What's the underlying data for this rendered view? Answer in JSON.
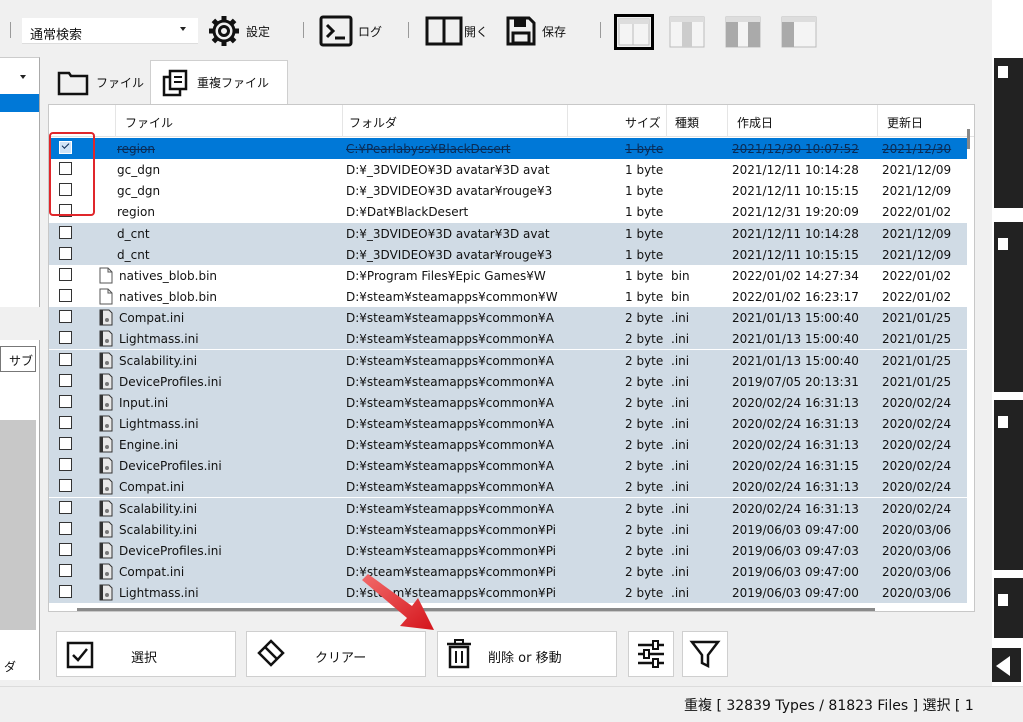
{
  "toolbar": {
    "search_mode": "通常検索",
    "settings_label": "設定",
    "log_label": "ログ",
    "open_label": "開く",
    "save_label": "保存"
  },
  "left": {
    "column_label": "サブ",
    "bottom_label": "ダ"
  },
  "tabs": [
    {
      "label": "ファイル",
      "icon": "folder-icon"
    },
    {
      "label": "重複ファイル",
      "icon": "duplicate-icon"
    }
  ],
  "columns": {
    "file": "ファイル",
    "folder": "フォルダ",
    "size": "サイズ",
    "type": "種類",
    "created": "作成日",
    "modified": "更新日"
  },
  "rows": [
    {
      "checked": true,
      "selected": true,
      "alt": false,
      "icon": "none",
      "file": "region",
      "folder": "C:¥Pearlabyss¥BlackDesert",
      "size": "1 byte",
      "type": "",
      "created": "2021/12/30 10:07:52",
      "modified": "2021/12/30"
    },
    {
      "checked": false,
      "selected": false,
      "alt": false,
      "icon": "none",
      "file": "gc_dgn",
      "folder": "D:¥_3DVIDEO¥3D avatar¥3D avat",
      "size": "1 byte",
      "type": "",
      "created": "2021/12/11 10:14:28",
      "modified": "2021/12/09"
    },
    {
      "checked": false,
      "selected": false,
      "alt": false,
      "icon": "none",
      "file": "gc_dgn",
      "folder": "D:¥_3DVIDEO¥3D avatar¥rouge¥3",
      "size": "1 byte",
      "type": "",
      "created": "2021/12/11 10:15:15",
      "modified": "2021/12/09"
    },
    {
      "checked": false,
      "selected": false,
      "alt": false,
      "icon": "none",
      "file": "region",
      "folder": "D:¥Dat¥BlackDesert",
      "size": "1 byte",
      "type": "",
      "created": "2021/12/31 19:20:09",
      "modified": "2022/01/02"
    },
    {
      "checked": false,
      "selected": false,
      "alt": true,
      "icon": "none",
      "file": "d_cnt",
      "folder": "D:¥_3DVIDEO¥3D avatar¥3D avat",
      "size": "1 byte",
      "type": "",
      "created": "2021/12/11 10:14:28",
      "modified": "2021/12/09"
    },
    {
      "checked": false,
      "selected": false,
      "alt": true,
      "icon": "none",
      "file": "d_cnt",
      "folder": "D:¥_3DVIDEO¥3D avatar¥rouge¥3",
      "size": "1 byte",
      "type": "",
      "created": "2021/12/11 10:15:15",
      "modified": "2021/12/09"
    },
    {
      "checked": false,
      "selected": false,
      "alt": false,
      "icon": "file",
      "file": "natives_blob.bin",
      "folder": "D:¥Program Files¥Epic Games¥W",
      "size": "1 byte",
      "type": "bin",
      "created": "2022/01/02 14:27:34",
      "modified": "2022/01/02"
    },
    {
      "checked": false,
      "selected": false,
      "alt": false,
      "icon": "file",
      "file": "natives_blob.bin",
      "folder": "D:¥steam¥steamapps¥common¥W",
      "size": "1 byte",
      "type": "bin",
      "created": "2022/01/02 16:23:17",
      "modified": "2022/01/02"
    },
    {
      "checked": false,
      "selected": false,
      "alt": true,
      "icon": "ini",
      "file": "Compat.ini",
      "folder": "D:¥steam¥steamapps¥common¥A",
      "size": "2 byte",
      "type": ".ini",
      "created": "2021/01/13 15:00:40",
      "modified": "2021/01/25"
    },
    {
      "checked": false,
      "selected": false,
      "alt": true,
      "icon": "ini",
      "file": "Lightmass.ini",
      "folder": "D:¥steam¥steamapps¥common¥A",
      "size": "2 byte",
      "type": ".ini",
      "created": "2021/01/13 15:00:40",
      "modified": "2021/01/25"
    },
    {
      "checked": false,
      "selected": false,
      "alt": true,
      "icon": "ini",
      "file": "Scalability.ini",
      "folder": "D:¥steam¥steamapps¥common¥A",
      "size": "2 byte",
      "type": ".ini",
      "created": "2021/01/13 15:00:40",
      "modified": "2021/01/25"
    },
    {
      "checked": false,
      "selected": false,
      "alt": true,
      "icon": "ini",
      "file": "DeviceProfiles.ini",
      "folder": "D:¥steam¥steamapps¥common¥A",
      "size": "2 byte",
      "type": ".ini",
      "created": "2019/07/05 20:13:31",
      "modified": "2021/01/25"
    },
    {
      "checked": false,
      "selected": false,
      "alt": true,
      "icon": "ini",
      "file": "Input.ini",
      "folder": "D:¥steam¥steamapps¥common¥A",
      "size": "2 byte",
      "type": ".ini",
      "created": "2020/02/24 16:31:13",
      "modified": "2020/02/24"
    },
    {
      "checked": false,
      "selected": false,
      "alt": true,
      "icon": "ini",
      "file": "Lightmass.ini",
      "folder": "D:¥steam¥steamapps¥common¥A",
      "size": "2 byte",
      "type": ".ini",
      "created": "2020/02/24 16:31:13",
      "modified": "2020/02/24"
    },
    {
      "checked": false,
      "selected": false,
      "alt": true,
      "icon": "ini",
      "file": "Engine.ini",
      "folder": "D:¥steam¥steamapps¥common¥A",
      "size": "2 byte",
      "type": ".ini",
      "created": "2020/02/24 16:31:13",
      "modified": "2020/02/24"
    },
    {
      "checked": false,
      "selected": false,
      "alt": true,
      "icon": "ini",
      "file": "DeviceProfiles.ini",
      "folder": "D:¥steam¥steamapps¥common¥A",
      "size": "2 byte",
      "type": ".ini",
      "created": "2020/02/24 16:31:15",
      "modified": "2020/02/24"
    },
    {
      "checked": false,
      "selected": false,
      "alt": true,
      "icon": "ini",
      "file": "Compat.ini",
      "folder": "D:¥steam¥steamapps¥common¥A",
      "size": "2 byte",
      "type": ".ini",
      "created": "2020/02/24 16:31:13",
      "modified": "2020/02/24"
    },
    {
      "checked": false,
      "selected": false,
      "alt": true,
      "icon": "ini",
      "file": "Scalability.ini",
      "folder": "D:¥steam¥steamapps¥common¥A",
      "size": "2 byte",
      "type": ".ini",
      "created": "2020/02/24 16:31:13",
      "modified": "2020/02/24"
    },
    {
      "checked": false,
      "selected": false,
      "alt": true,
      "icon": "ini",
      "file": "Scalability.ini",
      "folder": "D:¥steam¥steamapps¥common¥Pi",
      "size": "2 byte",
      "type": ".ini",
      "created": "2019/06/03 09:47:00",
      "modified": "2020/03/06"
    },
    {
      "checked": false,
      "selected": false,
      "alt": true,
      "icon": "ini",
      "file": "DeviceProfiles.ini",
      "folder": "D:¥steam¥steamapps¥common¥Pi",
      "size": "2 byte",
      "type": ".ini",
      "created": "2019/06/03 09:47:03",
      "modified": "2020/03/06"
    },
    {
      "checked": false,
      "selected": false,
      "alt": true,
      "icon": "ini",
      "file": "Compat.ini",
      "folder": "D:¥steam¥steamapps¥common¥Pi",
      "size": "2 byte",
      "type": ".ini",
      "created": "2019/06/03 09:47:00",
      "modified": "2020/03/06"
    },
    {
      "checked": false,
      "selected": false,
      "alt": true,
      "icon": "ini",
      "file": "Lightmass.ini",
      "folder": "D:¥steam¥steamapps¥common¥Pi",
      "size": "2 byte",
      "type": ".ini",
      "created": "2019/06/03 09:47:00",
      "modified": "2020/03/06"
    }
  ],
  "buttons": {
    "select_label": "選択",
    "clear_label": "クリアー",
    "delete_label": "削除 or 移動"
  },
  "status": {
    "text": "重複 [ 32839 Types / 81823 Files ]  選択 [ 1"
  },
  "colors": {
    "selection": "#0078d7",
    "alt_row": "#d0dbe5",
    "highlight": "#e0262b"
  }
}
